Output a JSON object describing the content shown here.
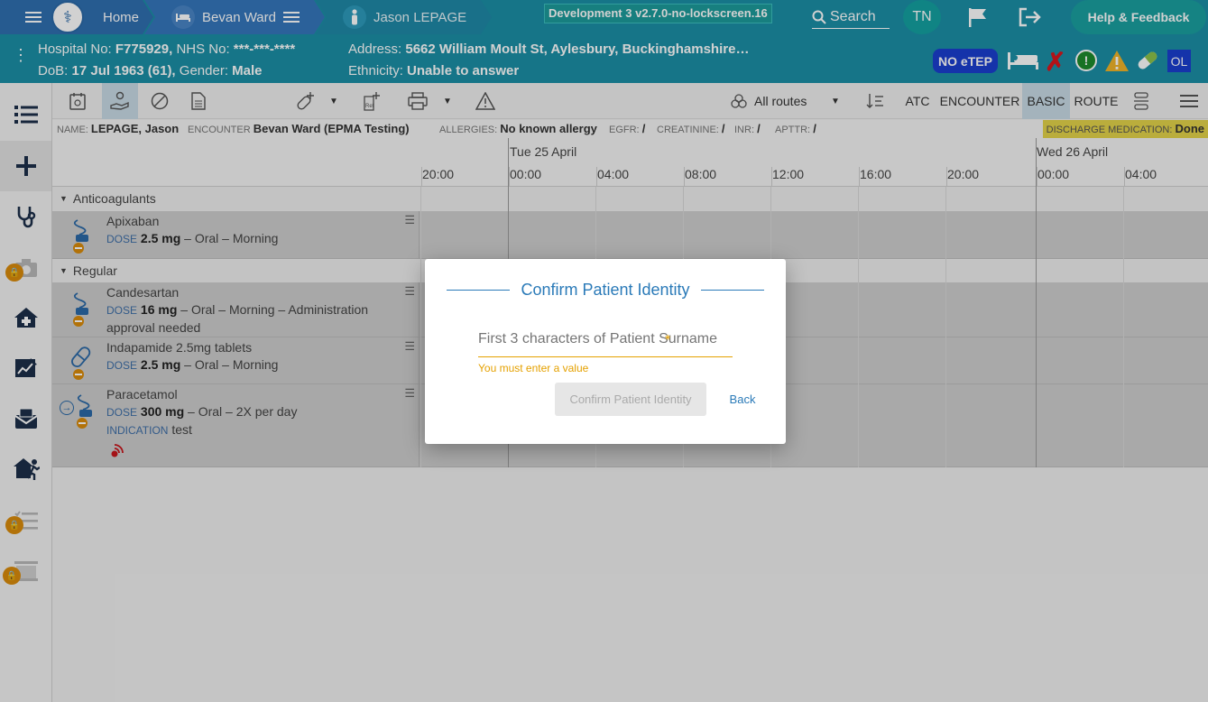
{
  "topbar": {
    "home_label": "Home",
    "ward_label": "Bevan Ward",
    "patient_label": "Jason LEPAGE",
    "env_label": "Development 3 v2.7.0-no-lockscreen.16",
    "search_label": "Search",
    "user_initials": "TN",
    "help_label": "Help & Feedback"
  },
  "banner": {
    "hospital_label": "Hospital No:",
    "hospital_no": "F775929,",
    "nhs_label": "NHS No:",
    "nhs_no": "***-***-****",
    "dob_label": "DoB:",
    "dob": "17 Jul 1963 (61),",
    "gender_label": "Gender:",
    "gender": "Male",
    "address_label": "Address:",
    "address": "5662 William Moult St, Aylesbury, Buckinghamshire…",
    "ethnicity_label": "Ethnicity:",
    "ethnicity": "Unable to answer",
    "noetep_label": "NO eTEP",
    "ol_label": "OL"
  },
  "toolbar": {
    "routes_label": "All routes",
    "atc_label": "ATC",
    "encounter_label": "ENCOUNTER",
    "basic_label": "BASIC",
    "route_label": "ROUTE"
  },
  "infoline": {
    "name_key": "NAME:",
    "name_val": "LEPAGE, Jason",
    "encounter_key": "ENCOUNTER",
    "encounter_val": "Bevan Ward (EPMA Testing)",
    "allergies_key": "ALLERGIES:",
    "allergies_val": "No known allergy",
    "egfr_key": "EGFR:",
    "egfr_val": "/",
    "creat_key": "CREATININE:",
    "creat_val": "/",
    "inr_key": "INR:",
    "inr_val": "/",
    "apttr_key": "APTTR:",
    "apttr_val": "/",
    "discharge_key": "DISCHARGE MEDICATION:",
    "discharge_val": "Done"
  },
  "timeline": {
    "day1": "Tue 25 April",
    "day2": "Wed 26 April",
    "times": [
      "20:00",
      "00:00",
      "04:00",
      "08:00",
      "12:00",
      "16:00",
      "20:00",
      "00:00",
      "04:00"
    ]
  },
  "sections": {
    "anticoag": "Anticoagulants",
    "regular": "Regular"
  },
  "meds": [
    {
      "name": "Apixaban",
      "dose_key": "DOSE",
      "dose": "2.5 mg",
      "rest": "– Oral – Morning"
    },
    {
      "name": "Candesartan",
      "dose_key": "DOSE",
      "dose": "16 mg",
      "rest": "– Oral – Morning – Administration approval needed"
    },
    {
      "name": "Indapamide 2.5mg tablets",
      "dose_key": "DOSE",
      "dose": "2.5 mg",
      "rest": "– Oral – Morning"
    },
    {
      "name": "Paracetamol",
      "dose_key": "DOSE",
      "dose": "300 mg",
      "rest": "– Oral – 2X per day",
      "ind_key": "INDICATION",
      "ind": "test"
    }
  ],
  "dialog": {
    "title": "Confirm Patient Identity",
    "placeholder": "First 3 characters of Patient Surname",
    "required_mark": "*",
    "error": "You must enter a value",
    "confirm_label": "Confirm Patient Identity",
    "back_label": "Back"
  },
  "colors": {
    "header_teal": "#1b8fa6",
    "accent_blue": "#2a7ab8",
    "warning_orange": "#e5a100"
  }
}
